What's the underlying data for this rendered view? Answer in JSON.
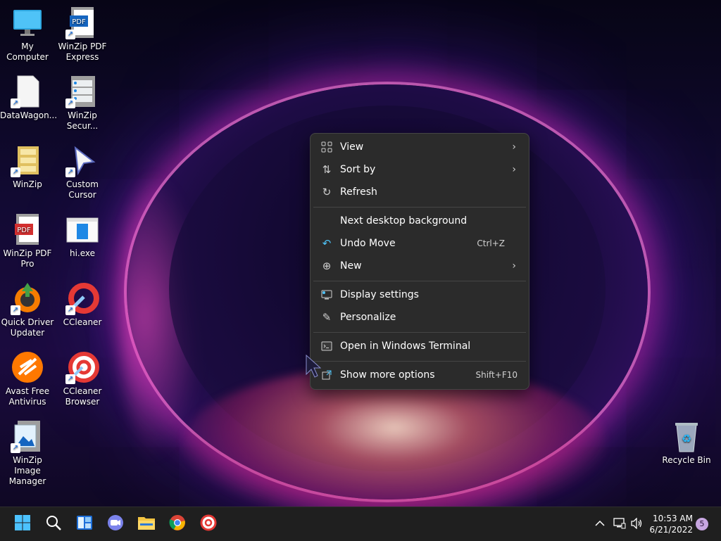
{
  "desktop_icons": [
    {
      "label": "My Computer",
      "icon": "monitor-icon"
    },
    {
      "label": "WinZip PDF Express",
      "icon": "pdf-icon"
    },
    {
      "label": "DataWagon...",
      "icon": "document-icon"
    },
    {
      "label": "WinZip Secur...",
      "icon": "server-icon"
    },
    {
      "label": "WinZip",
      "icon": "winzip-icon"
    },
    {
      "label": "Custom Cursor",
      "icon": "cursor-icon"
    },
    {
      "label": "WinZip PDF Pro",
      "icon": "pdf-icon"
    },
    {
      "label": "hi.exe",
      "icon": "exe-icon"
    },
    {
      "label": "Quick Driver Updater",
      "icon": "driver-updater-icon"
    },
    {
      "label": "CCleaner",
      "icon": "ccleaner-icon"
    },
    {
      "label": "Avast Free Antivirus",
      "icon": "avast-icon"
    },
    {
      "label": "CCleaner Browser",
      "icon": "ccleaner-browser-icon"
    },
    {
      "label": "WinZip Image Manager",
      "icon": "image-manager-icon"
    },
    {
      "label": "Recycle Bin",
      "icon": "recycle-bin-icon"
    }
  ],
  "context_menu": {
    "view": {
      "label": "View"
    },
    "sort_by": {
      "label": "Sort by"
    },
    "refresh": {
      "label": "Refresh"
    },
    "next_bg": {
      "label": "Next desktop background"
    },
    "undo_move": {
      "label": "Undo Move",
      "shortcut": "Ctrl+Z"
    },
    "new": {
      "label": "New"
    },
    "display_settings": {
      "label": "Display settings"
    },
    "personalize": {
      "label": "Personalize"
    },
    "open_terminal": {
      "label": "Open in Windows Terminal"
    },
    "show_more": {
      "label": "Show more options",
      "shortcut": "Shift+F10"
    }
  },
  "taskbar": {
    "apps": [
      "start-icon",
      "search-icon",
      "widgets-icon",
      "chat-icon",
      "file-explorer-icon",
      "chrome-icon",
      "ccleaner-browser-icon"
    ],
    "clock_time": "10:53 AM",
    "clock_date": "6/21/2022",
    "notification_count": "5"
  },
  "colors": {
    "menu_bg": "#2b2b2b",
    "taskbar_bg": "#1f1f1f"
  }
}
